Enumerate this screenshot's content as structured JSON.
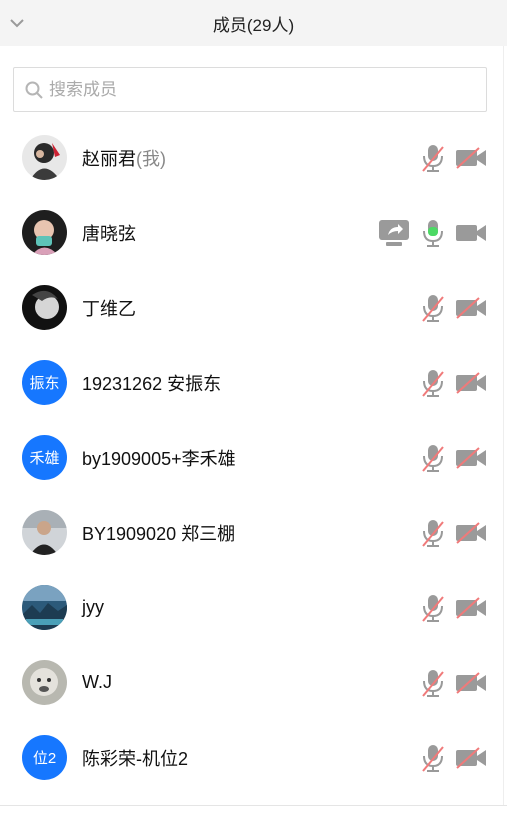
{
  "header": {
    "title": "成员(29人)"
  },
  "search": {
    "placeholder": "搜索成员"
  },
  "colors": {
    "accent": "#1677ff",
    "muted": "#9a9a9a",
    "slash": "#f07a7a",
    "active_mic": "#4cd964"
  },
  "members": [
    {
      "name": "赵丽君",
      "suffix": "(我)",
      "avatar": "photo",
      "mic": "off",
      "cam": "off"
    },
    {
      "name": "唐晓弦",
      "suffix": "",
      "avatar": "photo",
      "mic": "on",
      "cam": "on",
      "sharing": true
    },
    {
      "name": " 丁维乙",
      "suffix": "",
      "avatar": "photo",
      "mic": "off",
      "cam": "off"
    },
    {
      "name": "19231262 安振东",
      "suffix": "",
      "avatar_text": "振东",
      "mic": "off",
      "cam": "off"
    },
    {
      "name": "by1909005+李禾雄",
      "suffix": "",
      "avatar_text": "禾雄",
      "mic": "off",
      "cam": "off"
    },
    {
      "name": "BY1909020 郑三棚",
      "suffix": "",
      "avatar": "photo",
      "mic": "off",
      "cam": "off"
    },
    {
      "name": "jyy",
      "suffix": "",
      "avatar": "photo",
      "mic": "off",
      "cam": "off"
    },
    {
      "name": "W.J",
      "suffix": "",
      "avatar": "photo",
      "mic": "off",
      "cam": "off"
    },
    {
      "name": "陈彩荣-机位2",
      "suffix": "",
      "avatar_text": "位2",
      "mic": "off",
      "cam": "off"
    }
  ]
}
